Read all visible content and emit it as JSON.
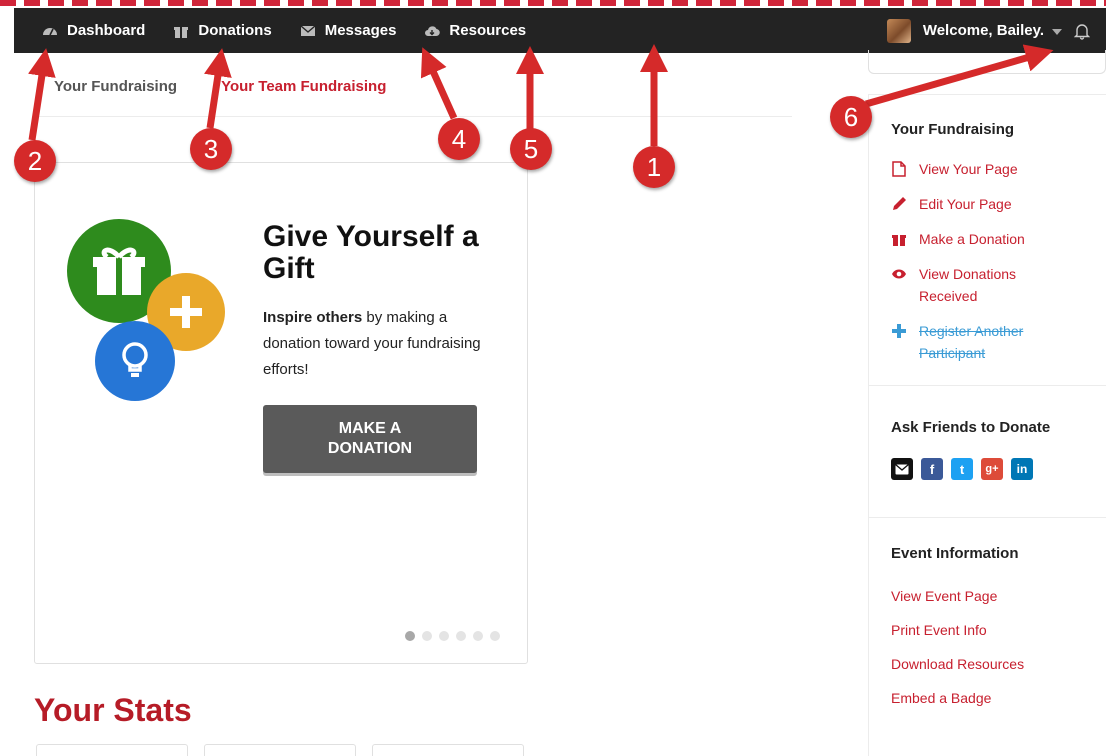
{
  "nav": {
    "items": [
      {
        "label": "Dashboard",
        "icon": "dashboard-icon"
      },
      {
        "label": "Donations",
        "icon": "gift-icon"
      },
      {
        "label": "Messages",
        "icon": "envelope-icon"
      },
      {
        "label": "Resources",
        "icon": "cloud-download-icon"
      }
    ],
    "welcome": "Welcome, Bailey."
  },
  "tabs": {
    "yours": "Your Fundraising",
    "team": "Your Team Fundraising"
  },
  "promo": {
    "title": "Give Yourself a Gift",
    "text_bold": "Inspire others",
    "text_rest": " by making a donation toward your fundraising efforts!",
    "button": "MAKE A DONATION",
    "slides": 6,
    "active_slide": 1
  },
  "stats": {
    "title": "Your Stats"
  },
  "sidebar": {
    "fundraising_title": "Your Fundraising",
    "links": [
      {
        "label": "View Your Page",
        "icon": "file-icon"
      },
      {
        "label": "Edit Your Page",
        "icon": "pencil-icon"
      },
      {
        "label": "Make a Donation",
        "icon": "gift-icon"
      },
      {
        "label": "View Donations Received",
        "icon": "eye-icon"
      },
      {
        "label": "Register Another Participant",
        "icon": "plus-icon"
      }
    ],
    "ask_title": "Ask Friends to Donate",
    "share": [
      {
        "label": "email",
        "color": "#111111"
      },
      {
        "label": "f",
        "color": "#3b5998"
      },
      {
        "label": "t",
        "color": "#1da1f2"
      },
      {
        "label": "g+",
        "color": "#dd4b39"
      },
      {
        "label": "in",
        "color": "#0077b5"
      }
    ],
    "event_title": "Event Information",
    "event_links": [
      "View Event Page",
      "Print Event Info",
      "Download Resources",
      "Embed a Badge"
    ]
  },
  "annotations": [
    "1",
    "2",
    "3",
    "4",
    "5",
    "6"
  ],
  "colors": {
    "accent": "#c7202f",
    "annotation": "#d52a2a",
    "nav_bg": "#232323"
  }
}
